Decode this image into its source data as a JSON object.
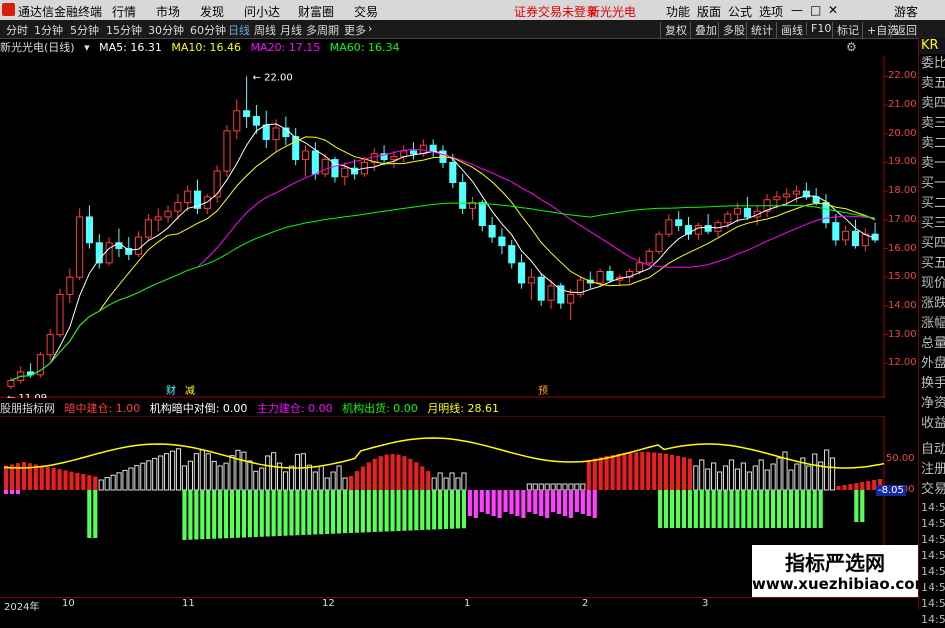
{
  "menubar": {
    "app_title": "通达信金融终端",
    "items": [
      "行情",
      "市场",
      "发现",
      "问小达",
      "财富圈",
      "交易"
    ],
    "warning": "证券交易未登录",
    "stock": "新光光电",
    "right_items": [
      "功能",
      "版面",
      "公式",
      "选项"
    ],
    "guest": "游客"
  },
  "toolbar": {
    "periods": [
      "分时",
      "1分钟",
      "5分钟",
      "15分钟",
      "30分钟",
      "60分钟",
      "日线",
      "周线",
      "月线",
      "多周期",
      "更多"
    ],
    "active_period": "日线",
    "right_buttons": [
      "复权",
      "叠加",
      "多股",
      "统计",
      "画线",
      "F10",
      "标记",
      "+自选",
      "返回"
    ]
  },
  "main_chart": {
    "stock_label": "新光光电(日线)",
    "ma5": "MA5: 16.31",
    "ma10": "MA10: 16.46",
    "ma20": "MA20: 17.15",
    "ma60": "MA60: 16.34",
    "high_mark": "22.00",
    "low_mark": "11.09",
    "event_marks": [
      "财",
      "减",
      "预"
    ],
    "y_ticks": [
      "22.00",
      "21.00",
      "20.00",
      "19.00",
      "18.00",
      "17.00",
      "16.00",
      "15.00",
      "14.00",
      "13.00",
      "12.00"
    ],
    "colors": {
      "up": "#ff3c3c",
      "down": "#54ffff",
      "ma5": "#ffffff",
      "ma10": "#ffff00",
      "ma20": "#ff00ff",
      "ma60": "#00ff00"
    }
  },
  "indicator": {
    "name": "股朋指标网",
    "items": [
      {
        "label": "暗中建仓: 1.00",
        "color": "#ff3c3c"
      },
      {
        "label": "机构暗中对倒: 0.00",
        "color": "#ffffff"
      },
      {
        "label": "主力建仓: 0.00",
        "color": "#ff00ff"
      },
      {
        "label": "机构出货: 0.00",
        "color": "#00ff00"
      },
      {
        "label": "月明线: 28.61",
        "color": "#ffff00"
      }
    ],
    "y_ticks": [
      "50.00",
      "25.00"
    ],
    "current_value": "-8.05"
  },
  "side_panel": {
    "items": [
      "委比",
      "卖五",
      "卖四",
      "卖三",
      "卖二",
      "卖一",
      "买一",
      "买二",
      "买三",
      "买四",
      "买五",
      "现价",
      "涨跌",
      "涨幅",
      "总量",
      "外盘",
      "换手",
      "净资",
      "收益"
    ],
    "lower_items": [
      "自动",
      "注册",
      "交易",
      "14:54",
      "14:54",
      "14:54",
      "14:54",
      "14:54",
      "14:55",
      "14:55",
      "14:55"
    ],
    "top_code": "KR"
  },
  "date_axis": {
    "labels": [
      "2024年",
      "10",
      "11",
      "12",
      "1",
      "2",
      "3"
    ]
  },
  "watermark": {
    "line1": "指标严选网",
    "line2": "www.xuezhibiao.com"
  },
  "chart_data": {
    "type": "candlestick",
    "title": "新光光电(日线)",
    "ylim": [
      11,
      22.5
    ],
    "candles": [
      [
        11.2,
        11.5,
        11.1,
        11.4
      ],
      [
        11.4,
        11.9,
        11.3,
        11.7
      ],
      [
        11.7,
        12.0,
        11.5,
        11.6
      ],
      [
        11.6,
        12.4,
        11.5,
        12.3
      ],
      [
        12.3,
        13.2,
        12.1,
        13.0
      ],
      [
        13.0,
        14.6,
        12.9,
        14.4
      ],
      [
        14.4,
        15.3,
        14.1,
        15.0
      ],
      [
        15.0,
        17.4,
        14.9,
        17.1
      ],
      [
        17.1,
        17.5,
        16.0,
        16.2
      ],
      [
        16.2,
        16.5,
        15.3,
        15.5
      ],
      [
        15.5,
        16.4,
        15.4,
        16.2
      ],
      [
        16.2,
        16.7,
        15.7,
        16.0
      ],
      [
        16.0,
        16.4,
        15.6,
        15.8
      ],
      [
        15.8,
        16.6,
        15.7,
        16.4
      ],
      [
        16.4,
        17.2,
        16.3,
        17.0
      ],
      [
        17.0,
        17.4,
        16.6,
        17.1
      ],
      [
        17.1,
        17.5,
        16.9,
        17.3
      ],
      [
        17.3,
        17.9,
        17.0,
        17.6
      ],
      [
        17.6,
        18.2,
        17.3,
        18.0
      ],
      [
        18.0,
        18.4,
        17.2,
        17.4
      ],
      [
        17.4,
        17.9,
        17.2,
        17.8
      ],
      [
        17.8,
        18.9,
        17.6,
        18.7
      ],
      [
        18.7,
        20.3,
        18.5,
        20.1
      ],
      [
        20.1,
        21.2,
        19.8,
        20.8
      ],
      [
        20.8,
        22.0,
        20.2,
        20.6
      ],
      [
        20.6,
        21.0,
        20.0,
        20.3
      ],
      [
        20.3,
        20.8,
        19.5,
        19.8
      ],
      [
        19.8,
        20.5,
        19.4,
        20.2
      ],
      [
        20.2,
        20.6,
        19.6,
        19.9
      ],
      [
        19.9,
        20.2,
        18.9,
        19.1
      ],
      [
        19.1,
        19.6,
        18.5,
        19.4
      ],
      [
        19.4,
        19.7,
        18.4,
        18.6
      ],
      [
        18.6,
        19.3,
        18.5,
        19.1
      ],
      [
        19.1,
        19.2,
        18.3,
        18.5
      ],
      [
        18.5,
        19.0,
        18.2,
        18.8
      ],
      [
        18.8,
        19.1,
        18.4,
        18.6
      ],
      [
        18.6,
        19.2,
        18.5,
        19.0
      ],
      [
        19.0,
        19.5,
        18.7,
        19.3
      ],
      [
        19.3,
        19.6,
        18.9,
        19.1
      ],
      [
        19.1,
        19.4,
        18.8,
        19.2
      ],
      [
        19.2,
        19.6,
        19.0,
        19.4
      ],
      [
        19.4,
        19.7,
        19.1,
        19.3
      ],
      [
        19.3,
        19.8,
        19.2,
        19.6
      ],
      [
        19.6,
        19.8,
        19.2,
        19.4
      ],
      [
        19.4,
        19.6,
        18.8,
        19.0
      ],
      [
        19.0,
        19.3,
        18.1,
        18.3
      ],
      [
        18.3,
        18.6,
        17.2,
        17.4
      ],
      [
        17.4,
        17.8,
        17.0,
        17.6
      ],
      [
        17.6,
        17.7,
        16.6,
        16.8
      ],
      [
        16.8,
        17.1,
        16.2,
        16.4
      ],
      [
        16.4,
        16.7,
        15.8,
        16.1
      ],
      [
        16.1,
        16.3,
        15.3,
        15.5
      ],
      [
        15.5,
        15.8,
        14.6,
        14.8
      ],
      [
        14.8,
        15.3,
        14.2,
        15.0
      ],
      [
        15.0,
        15.1,
        14.0,
        14.2
      ],
      [
        14.2,
        14.9,
        13.9,
        14.7
      ],
      [
        14.7,
        14.8,
        13.9,
        14.1
      ],
      [
        14.1,
        14.6,
        13.5,
        14.4
      ],
      [
        14.4,
        15.0,
        14.3,
        14.9
      ],
      [
        14.9,
        15.2,
        14.6,
        14.8
      ],
      [
        14.8,
        15.3,
        14.7,
        15.2
      ],
      [
        15.2,
        15.4,
        14.8,
        14.9
      ],
      [
        14.9,
        15.1,
        14.7,
        15.0
      ],
      [
        15.0,
        15.3,
        14.8,
        15.2
      ],
      [
        15.2,
        15.7,
        15.1,
        15.5
      ],
      [
        15.5,
        16.0,
        15.4,
        15.9
      ],
      [
        15.9,
        16.6,
        15.8,
        16.5
      ],
      [
        16.5,
        17.2,
        16.4,
        17.0
      ],
      [
        17.0,
        17.3,
        16.6,
        16.8
      ],
      [
        16.8,
        17.1,
        16.3,
        16.5
      ],
      [
        16.5,
        16.9,
        16.3,
        16.8
      ],
      [
        16.8,
        17.2,
        16.5,
        16.6
      ],
      [
        16.6,
        17.0,
        16.4,
        16.9
      ],
      [
        16.9,
        17.3,
        16.7,
        17.2
      ],
      [
        17.2,
        17.6,
        16.9,
        17.4
      ],
      [
        17.4,
        17.8,
        17.0,
        17.1
      ],
      [
        17.1,
        17.5,
        16.8,
        17.3
      ],
      [
        17.3,
        17.9,
        17.1,
        17.7
      ],
      [
        17.7,
        18.0,
        17.4,
        17.8
      ],
      [
        17.8,
        18.1,
        17.5,
        17.9
      ],
      [
        17.9,
        18.2,
        17.6,
        18.0
      ],
      [
        18.0,
        18.3,
        17.7,
        17.8
      ],
      [
        17.8,
        18.1,
        17.5,
        17.6
      ],
      [
        17.6,
        17.9,
        16.7,
        16.9
      ],
      [
        16.9,
        17.2,
        16.1,
        16.3
      ],
      [
        16.3,
        16.8,
        16.1,
        16.6
      ],
      [
        16.6,
        17.0,
        16.0,
        16.1
      ],
      [
        16.1,
        16.7,
        15.9,
        16.5
      ],
      [
        16.5,
        16.9,
        16.2,
        16.3
      ]
    ]
  }
}
